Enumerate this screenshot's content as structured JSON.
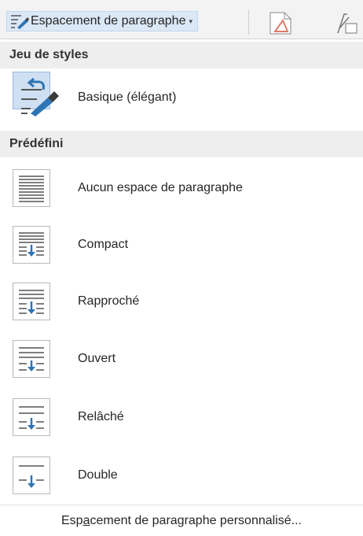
{
  "ribbon": {
    "dropdown_label": "Espacement de paragraphe",
    "dropdown_caret": "▾"
  },
  "menu": {
    "style_set_header": "Jeu de styles",
    "style_set_items": [
      {
        "label": "Basique (élégant)",
        "icon": "paragraph-spacing-brush-icon",
        "selected": true
      }
    ],
    "predefined_header": "Prédéfini",
    "predefined_items": [
      {
        "label": "Aucun espace de paragraphe",
        "icon": "no-spacing-icon"
      },
      {
        "label": "Compact",
        "icon": "compact-spacing-icon"
      },
      {
        "label": "Rapproché",
        "icon": "tight-spacing-icon"
      },
      {
        "label": "Ouvert",
        "icon": "open-spacing-icon"
      },
      {
        "label": "Relâché",
        "icon": "relaxed-spacing-icon"
      },
      {
        "label": "Double",
        "icon": "double-spacing-icon"
      }
    ],
    "custom": {
      "prefix": "Esp",
      "access_key": "a",
      "suffix": "cement de paragraphe personnalisé..."
    }
  },
  "colors": {
    "accent_blue": "#2e75b6",
    "selected_bg": "#cfe0f2",
    "header_bg": "#eeeeee",
    "ribbon_bg": "#f3f3f3",
    "icon_red": "#d24726"
  }
}
